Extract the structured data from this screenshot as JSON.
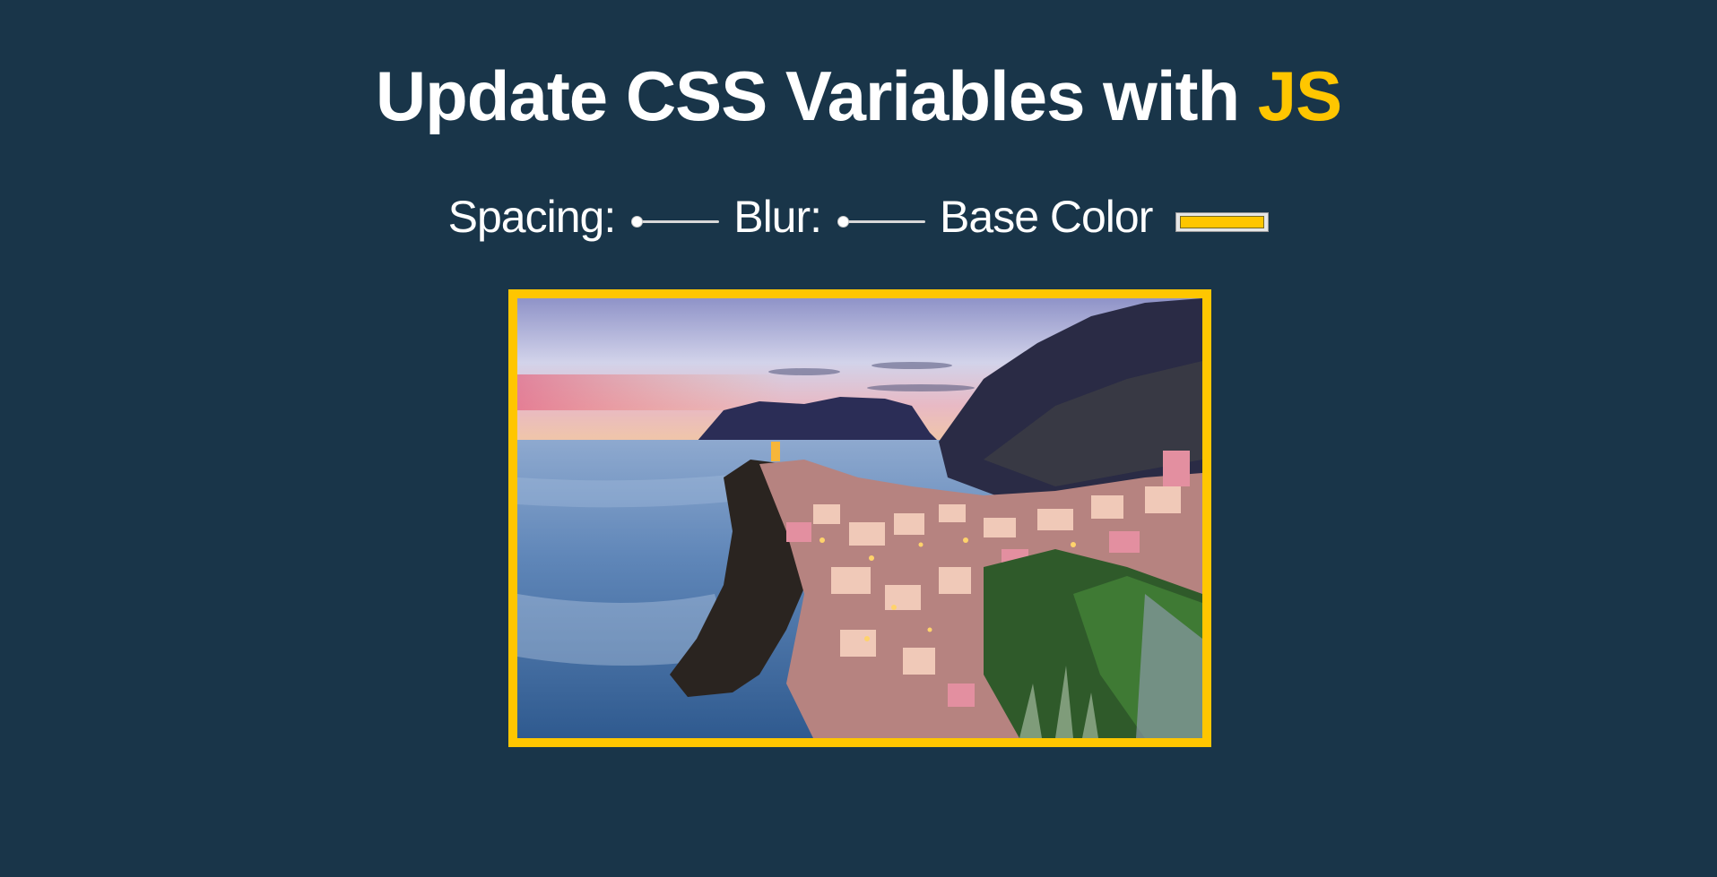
{
  "title": {
    "main": "Update CSS Variables with ",
    "highlight": "JS"
  },
  "controls": {
    "spacing_label": "Spacing:",
    "blur_label": "Blur:",
    "base_color_label": "Base Color",
    "spacing_value_fraction": 0.0,
    "blur_value_fraction": 0.0,
    "base_color": "#ffc600"
  },
  "colors": {
    "background": "#193549",
    "accent": "#ffc600",
    "text": "#ffffff"
  }
}
